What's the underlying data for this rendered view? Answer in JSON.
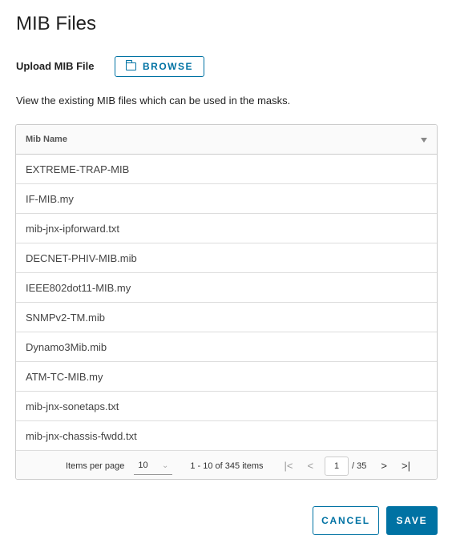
{
  "page": {
    "title": "MIB Files",
    "upload_label": "Upload MIB File",
    "browse_label": "BROWSE",
    "description": "View the existing MIB files which can be used in the masks."
  },
  "grid": {
    "column": "Mib Name",
    "rows": [
      "EXTREME-TRAP-MIB",
      "IF-MIB.my",
      "mib-jnx-ipforward.txt",
      "DECNET-PHIV-MIB.mib",
      "IEEE802dot11-MIB.my",
      "SNMPv2-TM.mib",
      "Dynamo3Mib.mib",
      "ATM-TC-MIB.my",
      "mib-jnx-sonetaps.txt",
      "mib-jnx-chassis-fwdd.txt"
    ]
  },
  "footer": {
    "items_per_page_label": "Items per page",
    "items_per_page": "10",
    "range": "1 - 10 of 345 items",
    "current_page": "1",
    "total_pages": "/ 35",
    "first": "|<",
    "prev": "<",
    "next": ">",
    "last": ">|"
  },
  "actions": {
    "cancel": "CANCEL",
    "save": "SAVE"
  },
  "colors": {
    "accent": "#0072a3"
  }
}
